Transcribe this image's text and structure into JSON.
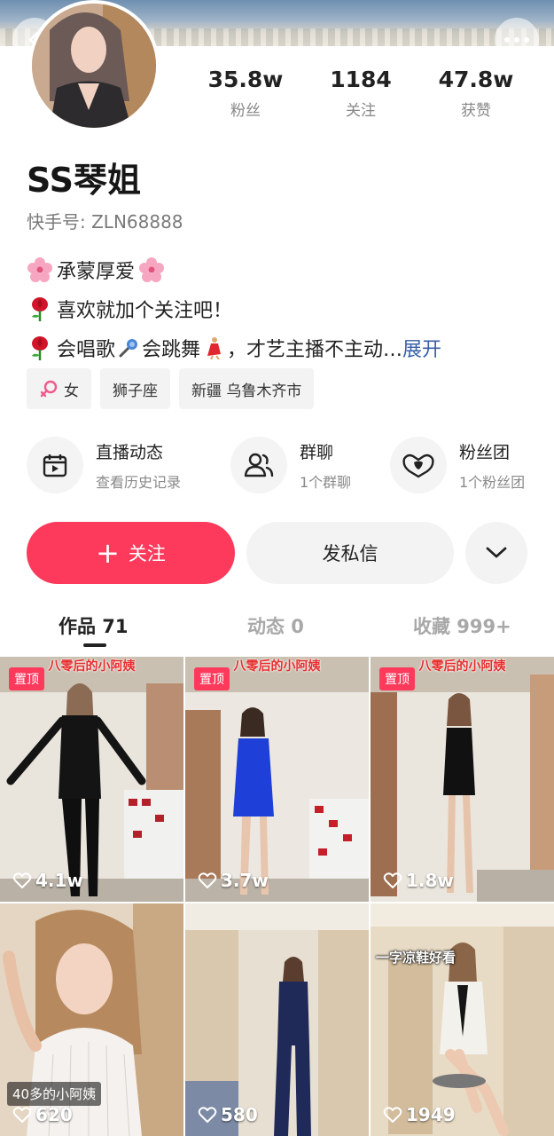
{
  "profile": {
    "nickname": "SS琴姐",
    "kuaishou_id": "快手号: ZLN68888",
    "stats": [
      {
        "value": "35.8w",
        "label": "粉丝"
      },
      {
        "value": "1184",
        "label": "关注"
      },
      {
        "value": "47.8w",
        "label": "获赞"
      }
    ],
    "bio": {
      "line1": "承蒙厚爱",
      "line2": "喜欢就加个关注吧！",
      "line3_a": "会唱歌",
      "line3_b": "会跳舞",
      "line3_c": "，才艺主播不主动…",
      "expand": "展开"
    },
    "tags": {
      "gender": "女",
      "zodiac": "狮子座",
      "location": "新疆 乌鲁木齐市"
    }
  },
  "features": [
    {
      "title": "直播动态",
      "subtitle": "查看历史记录",
      "icon": "calendar-play-icon"
    },
    {
      "title": "群聊",
      "subtitle": "1个群聊",
      "icon": "group-icon"
    },
    {
      "title": "粉丝团",
      "subtitle": "1个粉丝团",
      "icon": "heart-badge-icon"
    }
  ],
  "actions": {
    "follow_label": "关注",
    "message_label": "发私信"
  },
  "tabs": [
    {
      "label": "作品 71"
    },
    {
      "label": "动态 0"
    },
    {
      "label": "收藏 999+"
    }
  ],
  "videos": [
    {
      "pinned": "置顶",
      "likes": "4.1w",
      "caption": "八零后的小阿姨"
    },
    {
      "pinned": "置顶",
      "likes": "3.7w",
      "caption": "八零后的小阿姨"
    },
    {
      "pinned": "置顶",
      "likes": "1.8w",
      "caption": "八零后的小阿姨"
    },
    {
      "likes": "620",
      "caption": "40多的小阿姨"
    },
    {
      "likes": "580"
    },
    {
      "likes": "1949",
      "caption": "一字凉鞋好看"
    }
  ],
  "colors": {
    "accent": "#fd3a5c",
    "link": "#385fa8"
  }
}
